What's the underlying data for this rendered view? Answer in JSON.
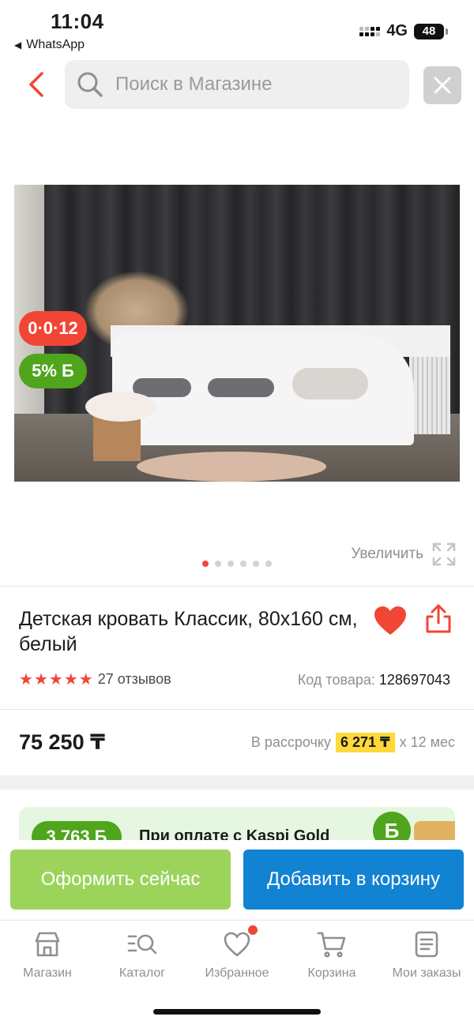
{
  "status_bar": {
    "time": "11:04",
    "back_app": "WhatsApp",
    "network": "4G",
    "battery": "48"
  },
  "search": {
    "placeholder": "Поиск в Магазине"
  },
  "product": {
    "badges": {
      "installment": "0·0·12",
      "bonus_percent": "5%",
      "bonus_symbol": "Б"
    },
    "image_pages": {
      "count": 6,
      "active": 1
    },
    "zoom_label": "Увеличить",
    "title": "Детская кровать Классик, 80x160 см, белый",
    "rating": 5,
    "reviews": "27 отзывов",
    "sku_label": "Код товара:",
    "sku_value": "128697043",
    "price": "75 250 ₸",
    "installment_prefix": "В рассрочку",
    "installment_amount": "6 271 ₸",
    "installment_suffix": "x 12 мес"
  },
  "promo": {
    "badge": "3 763 Б",
    "text": "При оплате с Kaspi Gold",
    "coin": "Б"
  },
  "actions": {
    "buy_now": "Оформить сейчас",
    "add_to_cart": "Добавить в корзину"
  },
  "bottom_nav": {
    "items": [
      {
        "label": "Магазин",
        "icon": "store-icon"
      },
      {
        "label": "Каталог",
        "icon": "catalog-search-icon"
      },
      {
        "label": "Избранное",
        "icon": "heart-outline-icon"
      },
      {
        "label": "Корзина",
        "icon": "cart-icon"
      },
      {
        "label": "Мои заказы",
        "icon": "orders-icon"
      }
    ]
  },
  "colors": {
    "accent_red": "#f14635",
    "bonus_green": "#4fa51c",
    "buy_green": "#9cd45b",
    "cart_blue": "#1283d3",
    "installment_yellow": "#ffd83a"
  }
}
